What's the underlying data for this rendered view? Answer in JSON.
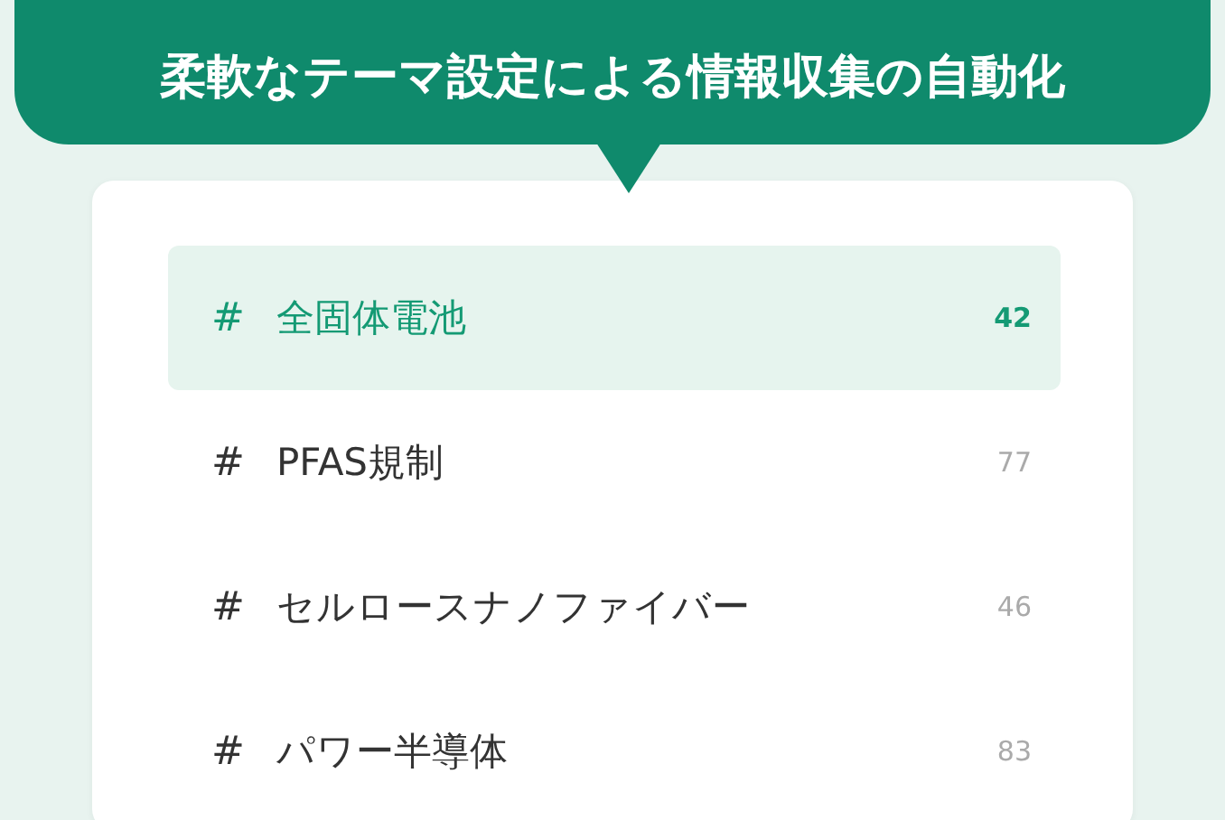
{
  "banner": {
    "title": "柔軟なテーマ設定による情報収集の自動化"
  },
  "topics": [
    {
      "mark": "#",
      "label": "全固体電池",
      "count": "42",
      "selected": true
    },
    {
      "mark": "#",
      "label": "PFAS規制",
      "count": "77",
      "selected": false
    },
    {
      "mark": "#",
      "label": "セルロースナノファイバー",
      "count": "46",
      "selected": false
    },
    {
      "mark": "#",
      "label": "パワー半導体",
      "count": "83",
      "selected": false
    }
  ]
}
